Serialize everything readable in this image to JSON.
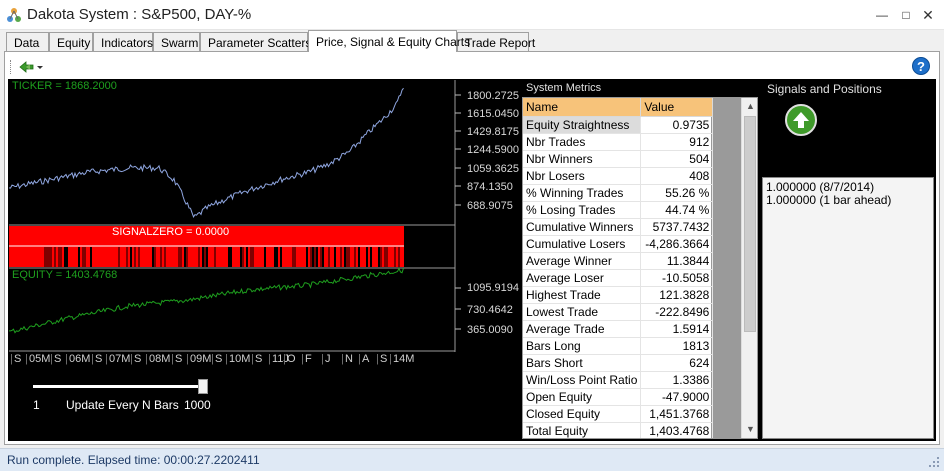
{
  "window": {
    "title": "Dakota System : S&P500, DAY-%"
  },
  "tabs": [
    {
      "label": "Data",
      "active": false
    },
    {
      "label": "Equity",
      "active": false
    },
    {
      "label": "Indicators",
      "active": false
    },
    {
      "label": "Swarm",
      "active": false
    },
    {
      "label": "Parameter Scatters",
      "active": false
    },
    {
      "label": "Price, Signal & Equity Charts",
      "active": true
    },
    {
      "label": "Trade Report",
      "active": false
    }
  ],
  "charts": {
    "ticker_readout": "TICKER = 1868.2000",
    "signal_readout": "SIGNALZERO = 0.0000",
    "equity_readout": "EQUITY = 1403.4768",
    "price_scale": [
      "1800.2725",
      "1615.0450",
      "1429.8175",
      "1244.5900",
      "1059.3625",
      "874.1350",
      "688.9075"
    ],
    "equity_scale": [
      "1095.9194",
      "730.4642",
      "365.0090"
    ],
    "date_ticks": [
      "S",
      "05M",
      "S",
      "06M",
      "S",
      "07M",
      "S",
      "08M",
      "S",
      "09M",
      "S",
      "10M",
      "S",
      "11J",
      "O",
      "F",
      "J",
      "N",
      "A",
      "S",
      "14M"
    ],
    "colors": {
      "price": "#8fa6e0",
      "signal": "#ff0000",
      "equity": "#1e9e1e"
    }
  },
  "slider": {
    "min_label": "1",
    "caption": "Update Every N Bars",
    "max_label": "1000"
  },
  "metrics": {
    "title": "System Metrics",
    "col_name": "Name",
    "col_value": "Value",
    "rows": [
      {
        "name": "Equity Straightness",
        "value": "0.9735"
      },
      {
        "name": "Nbr Trades",
        "value": "912"
      },
      {
        "name": "Nbr Winners",
        "value": "504"
      },
      {
        "name": "Nbr Losers",
        "value": "408"
      },
      {
        "name": "% Winning Trades",
        "value": "55.26 %"
      },
      {
        "name": "% Losing Trades",
        "value": "44.74 %"
      },
      {
        "name": "Cumulative Winners",
        "value": "5737.7432"
      },
      {
        "name": "Cumulative Losers",
        "value": "-4,286.3664"
      },
      {
        "name": "Average Winner",
        "value": "11.3844"
      },
      {
        "name": "Average Loser",
        "value": "-10.5058"
      },
      {
        "name": "Highest Trade",
        "value": "121.3828"
      },
      {
        "name": "Lowest Trade",
        "value": "-222.8496"
      },
      {
        "name": "Average Trade",
        "value": "1.5914"
      },
      {
        "name": "Bars Long",
        "value": "1813"
      },
      {
        "name": "Bars Short",
        "value": "624"
      },
      {
        "name": "Win/Loss Point Ratio",
        "value": "1.3386"
      },
      {
        "name": "Open Equity",
        "value": "-47.9000"
      },
      {
        "name": "Closed Equity",
        "value": "1,451.3768"
      },
      {
        "name": "Total Equity",
        "value": "1,403.4768"
      }
    ]
  },
  "signals": {
    "title": "Signals and Positions",
    "positions": [
      "1.000000 (8/7/2014)",
      "1.000000 (1 bar ahead)"
    ]
  },
  "status": {
    "text": "Run complete.  Elapsed time: 00:00:27.2202411"
  }
}
